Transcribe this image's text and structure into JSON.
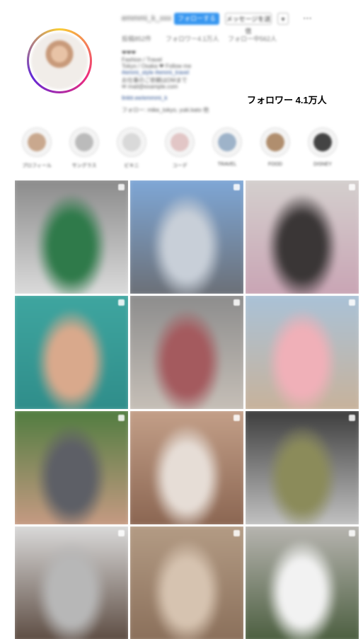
{
  "profile": {
    "username": "emmmi_k_xxx",
    "follow_label": "フォローする",
    "message_label": "メッセージを送信",
    "more_label": "⋯",
    "stats": [
      {
        "label": "投稿852件"
      },
      {
        "label": "フォロワー4.1万人"
      },
      {
        "label": "フォロー中562人"
      }
    ],
    "bio_lines": [
      "❤︎❤︎❤︎",
      "Fashion / Travel",
      "Tokyo / Osaka ❤ Follow me",
      "#emmi_style #emmi_travel",
      "お仕事のご依頼はDMまで",
      "✉ mail@example.com",
      "linktr.ee/emmmi_k",
      "フォロー: mike_tokyo, yuki.kato 他"
    ]
  },
  "overlay": {
    "follower_text": "フォロワー 4.1万人"
  },
  "highlights": [
    {
      "label": "プロフィール",
      "icon": "photo-icon",
      "color": "#c9a88e"
    },
    {
      "label": "サングラス",
      "icon": "sunglasses-icon",
      "color": "#bbbbbb"
    },
    {
      "label": "ビキニ",
      "icon": "bikini-icon",
      "color": "#d9d9d9"
    },
    {
      "label": "コーデ",
      "icon": "outfit-icon",
      "color": "#e2c6c6"
    },
    {
      "label": "TRAVEL",
      "icon": "travel-icon",
      "color": "#9eb3c9"
    },
    {
      "label": "FOOD",
      "icon": "food-icon",
      "color": "#b08e6e"
    },
    {
      "label": "DISNEY",
      "icon": "mouse-icon",
      "color": "#444444"
    }
  ],
  "grid": [
    {
      "name": "post-couple-green-sweater",
      "colors": [
        "#8a8a8a",
        "#2f7a4a",
        "#dcdcdc"
      ]
    },
    {
      "name": "post-castle",
      "colors": [
        "#7fa8d8",
        "#c8cfd8",
        "#6b6f76"
      ]
    },
    {
      "name": "post-couple-sofa",
      "colors": [
        "#d4d0ce",
        "#3a3636",
        "#c9a4b4"
      ]
    },
    {
      "name": "post-turquoise-top",
      "colors": [
        "#3fa6a0",
        "#d9a98c",
        "#2f8d8a"
      ]
    },
    {
      "name": "post-crouching-street",
      "colors": [
        "#8c8c8c",
        "#a45a5e",
        "#c7c0b8"
      ]
    },
    {
      "name": "post-beach-pink-bikini",
      "colors": [
        "#a9c2d8",
        "#f0b0b8",
        "#c8b29a"
      ]
    },
    {
      "name": "post-friends-selfie",
      "colors": [
        "#4f7c3f",
        "#5d5f66",
        "#c89b84"
      ]
    },
    {
      "name": "post-pointing-face",
      "colors": [
        "#c4a089",
        "#e6ddd6",
        "#8a6551"
      ]
    },
    {
      "name": "post-escalator",
      "colors": [
        "#3b3b3b",
        "#8b8b5a",
        "#c4c4c4"
      ]
    },
    {
      "name": "post-white-wall-pose",
      "colors": [
        "#dcdcdc",
        "#b7b7b7",
        "#5b4a40"
      ]
    },
    {
      "name": "post-cap-sunlight",
      "colors": [
        "#b49c85",
        "#d6c3b0",
        "#8a6f5a"
      ]
    },
    {
      "name": "post-white-shirt-street",
      "colors": [
        "#b9b6b2",
        "#f2f2f2",
        "#4a5d3e"
      ]
    }
  ]
}
